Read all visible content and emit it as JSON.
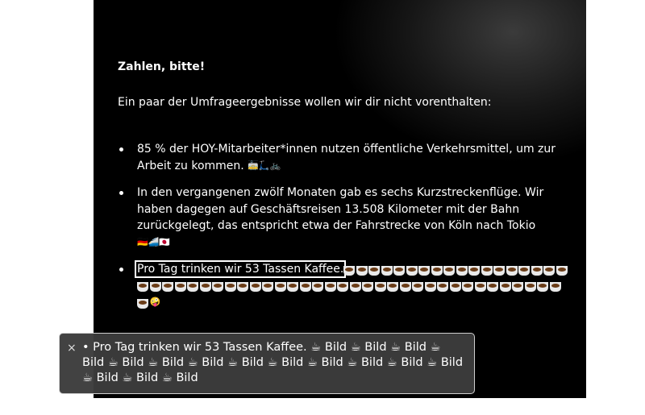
{
  "content": {
    "heading": "Zahlen, bitte!",
    "intro": "Ein paar der Umfrageergebnisse wollen wir dir nicht vorenthalten:",
    "bullets": [
      {
        "text": "85 % der HOY-Mitarbeiter*innen nutzen öffentliche Verkehrsmittel, um zur Arbeit zu kommen.",
        "emoji": "🚋🛴🚲"
      },
      {
        "text": "In den vergangenen zwölf Monaten gab es sechs Kurzstreckenflüge. Wir haben dagegen auf Geschäftsreisen 13.508 Kilometer mit der Bahn zurückgelegt, das entspricht etwa der Fahrstrecke von Köln nach Tokio",
        "emoji": "🇩🇪🚄🇯🇵"
      },
      {
        "text": "Pro Tag trinken wir 53 Tassen Kaffee.",
        "emoji_icon": "coffee-cup-icon",
        "emoji_count": 53,
        "end_emoji": "🤪"
      }
    ]
  },
  "voiceover": {
    "close_label": "×",
    "text": "• Pro Tag trinken wir 53 Tassen Kaffee.  ☕ Bild ☕ Bild ☕ Bild ☕ Bild ☕ Bild ☕ Bild ☕ Bild ☕ Bild ☕ Bild ☕ Bild ☕ Bild ☕ Bild ☕ Bild ☕ Bild ☕ Bild ☕ Bild"
  }
}
